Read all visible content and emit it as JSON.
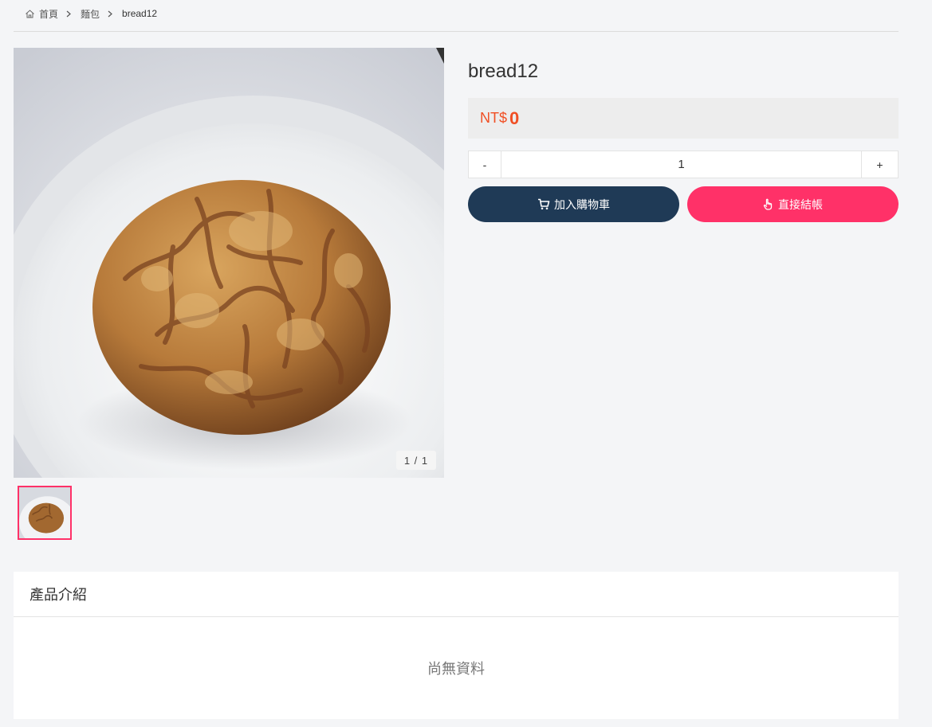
{
  "breadcrumb": {
    "home_label": "首頁",
    "category_label": "麵包",
    "current_label": "bread12"
  },
  "gallery": {
    "counter": "1 / 1",
    "main_image_icon": "bread-photo",
    "thumbnail_icon": "bread-photo"
  },
  "product": {
    "name": "bread12",
    "currency": "NT$",
    "price": "0"
  },
  "quantity": {
    "minus_label": "-",
    "value": "1",
    "plus_label": "+"
  },
  "actions": {
    "add_to_cart_label": "加入購物車",
    "add_to_cart_icon": "cart-icon",
    "checkout_label": "直接結帳",
    "checkout_icon": "hand-pointer-icon"
  },
  "intro": {
    "title": "產品介紹",
    "empty_text": "尚無資料"
  },
  "colors": {
    "accent_pink": "#ff3168",
    "navy": "#1f3a56",
    "price_red": "#f04f24"
  }
}
